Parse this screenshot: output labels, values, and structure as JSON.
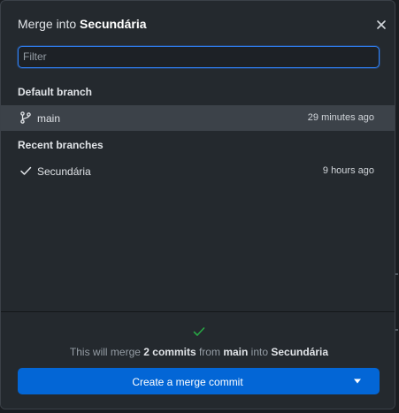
{
  "dialog": {
    "title_prefix": "Merge into",
    "title_target": "Secundária",
    "close_icon": "close-icon"
  },
  "filter": {
    "placeholder": "Filter",
    "value": ""
  },
  "default_branch": {
    "header": "Default branch",
    "items": [
      {
        "name": "main",
        "time": "29 minutes ago",
        "icon": "git-branch-icon",
        "selected": true
      }
    ]
  },
  "recent_branches": {
    "header": "Recent branches",
    "items": [
      {
        "name": "Secundária",
        "time": "9 hours ago",
        "icon": "check-icon",
        "selected": false
      }
    ]
  },
  "footer": {
    "status_icon": "check-icon",
    "summary": {
      "prefix": "This will merge",
      "count": "2 commits",
      "from_word": "from",
      "source": "main",
      "into_word": "into",
      "target": "Secundária"
    },
    "button_label": "Create a merge commit",
    "dropdown_icon": "triangle-down-icon"
  },
  "colors": {
    "accent": "#0366d6",
    "focus_ring": "#2f81f7",
    "success": "#28a745",
    "selected_row": "#3c4249",
    "background": "#24292e"
  }
}
